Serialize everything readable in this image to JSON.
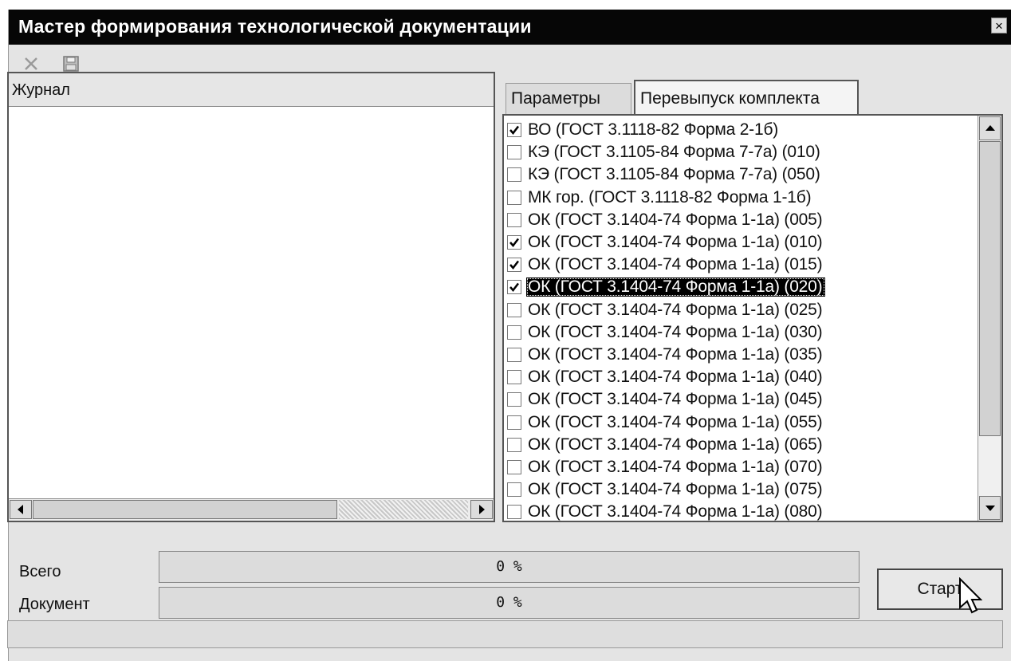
{
  "window": {
    "title": "Мастер формирования технологической документации",
    "close_glyph": "×"
  },
  "toolbar": {
    "delete_icon": "close-x-icon",
    "save_icon": "floppy-disk-icon"
  },
  "journal": {
    "header": "Журнал"
  },
  "tabs": [
    {
      "label": "Параметры",
      "active": false
    },
    {
      "label": "Перевыпуск комплекта",
      "active": true
    }
  ],
  "documents": [
    {
      "label": "ВО (ГОСТ 3.1118-82 Форма 2-1б)",
      "checked": true,
      "selected": false
    },
    {
      "label": "КЭ (ГОСТ 3.1105-84 Форма 7-7а) (010)",
      "checked": false,
      "selected": false
    },
    {
      "label": "КЭ (ГОСТ 3.1105-84 Форма 7-7а) (050)",
      "checked": false,
      "selected": false
    },
    {
      "label": "МК гор. (ГОСТ 3.1118-82 Форма 1-1б)",
      "checked": false,
      "selected": false
    },
    {
      "label": "ОК (ГОСТ 3.1404-74 Форма 1-1а) (005)",
      "checked": false,
      "selected": false
    },
    {
      "label": "ОК (ГОСТ 3.1404-74 Форма 1-1а) (010)",
      "checked": true,
      "selected": false
    },
    {
      "label": "ОК (ГОСТ 3.1404-74 Форма 1-1а) (015)",
      "checked": true,
      "selected": false
    },
    {
      "label": "ОК (ГОСТ 3.1404-74 Форма 1-1а) (020)",
      "checked": true,
      "selected": true
    },
    {
      "label": "ОК (ГОСТ 3.1404-74 Форма 1-1а) (025)",
      "checked": false,
      "selected": false
    },
    {
      "label": "ОК (ГОСТ 3.1404-74 Форма 1-1а) (030)",
      "checked": false,
      "selected": false
    },
    {
      "label": "ОК (ГОСТ 3.1404-74 Форма 1-1а) (035)",
      "checked": false,
      "selected": false
    },
    {
      "label": "ОК (ГОСТ 3.1404-74 Форма 1-1а) (040)",
      "checked": false,
      "selected": false
    },
    {
      "label": "ОК (ГОСТ 3.1404-74 Форма 1-1а) (045)",
      "checked": false,
      "selected": false
    },
    {
      "label": "ОК (ГОСТ 3.1404-74 Форма 1-1а) (055)",
      "checked": false,
      "selected": false
    },
    {
      "label": "ОК (ГОСТ 3.1404-74 Форма 1-1а) (065)",
      "checked": false,
      "selected": false
    },
    {
      "label": "ОК (ГОСТ 3.1404-74 Форма 1-1а) (070)",
      "checked": false,
      "selected": false
    },
    {
      "label": "ОК (ГОСТ 3.1404-74 Форма 1-1а) (075)",
      "checked": false,
      "selected": false
    },
    {
      "label": "ОК (ГОСТ 3.1404-74 Форма 1-1а) (080)",
      "checked": false,
      "selected": false
    }
  ],
  "progress": {
    "total_label": "Всего",
    "total_value": "0 %",
    "total_percent": 0,
    "document_label": "Документ",
    "document_value": "0 %",
    "document_percent": 0
  },
  "start_button": {
    "label": "Старт"
  },
  "colors": {
    "title_bar": "#060606",
    "selection": "#000000",
    "window_bg": "#e4e4e4"
  }
}
